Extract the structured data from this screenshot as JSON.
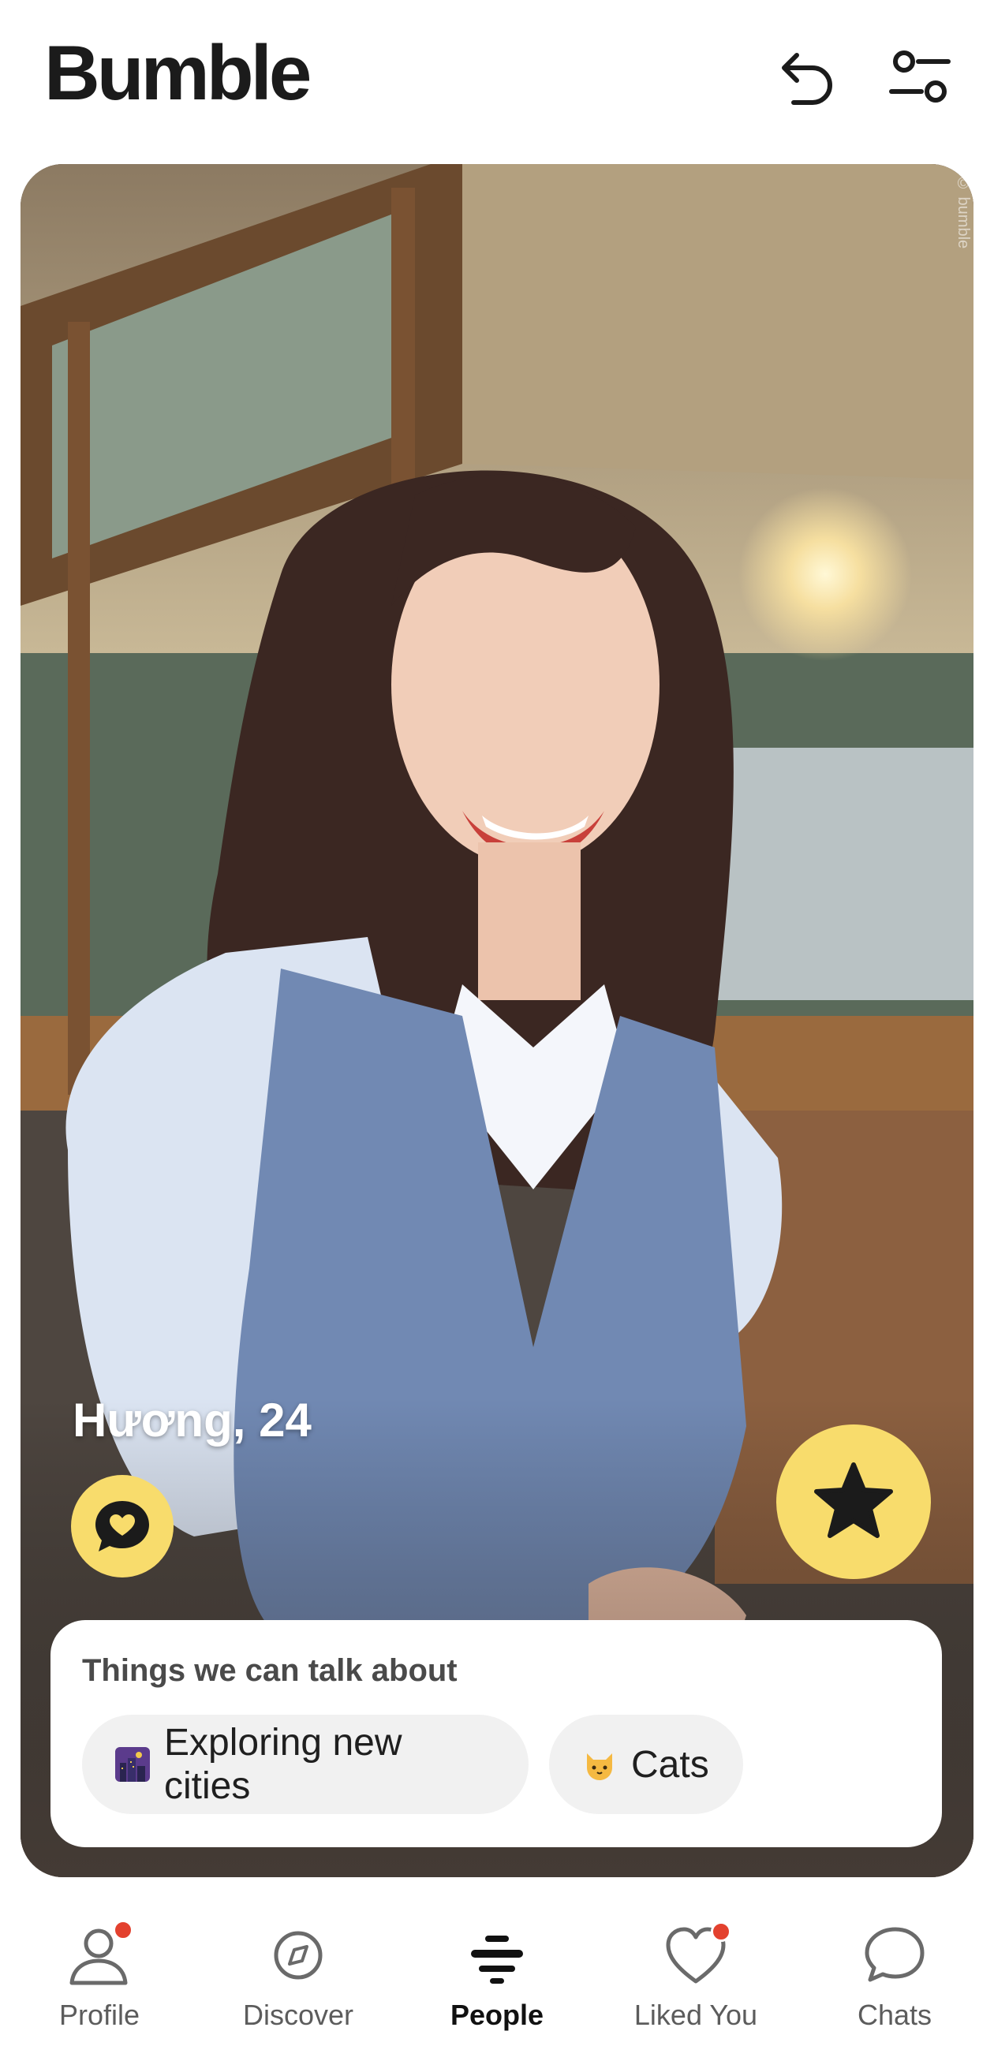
{
  "header": {
    "brand": "Bumble",
    "undo_icon": "undo-icon",
    "filter_icon": "filter-sliders-icon"
  },
  "card": {
    "name_age": "Hương, 24",
    "watermark": "© bumble",
    "chat_icon": "chat-heart-icon",
    "superswipe_icon": "star-icon",
    "accent": "#f8dc6c",
    "talk": {
      "title": "Things we can talk about",
      "chips": [
        {
          "emoji": "city-night-emoji",
          "label": "Exploring new cities"
        },
        {
          "emoji": "cat-face-emoji",
          "label": "Cats"
        }
      ]
    }
  },
  "tabbar": {
    "tabs": [
      {
        "label": "Profile",
        "icon": "profile-icon",
        "badge": true
      },
      {
        "label": "Discover",
        "icon": "compass-icon",
        "badge": false
      },
      {
        "label": "People",
        "icon": "people-stack-icon",
        "badge": false,
        "active": true
      },
      {
        "label": "Liked You",
        "icon": "heart-icon",
        "badge": true
      },
      {
        "label": "Chats",
        "icon": "chat-bubble-icon",
        "badge": false
      }
    ],
    "badge_color": "#e3412e"
  }
}
